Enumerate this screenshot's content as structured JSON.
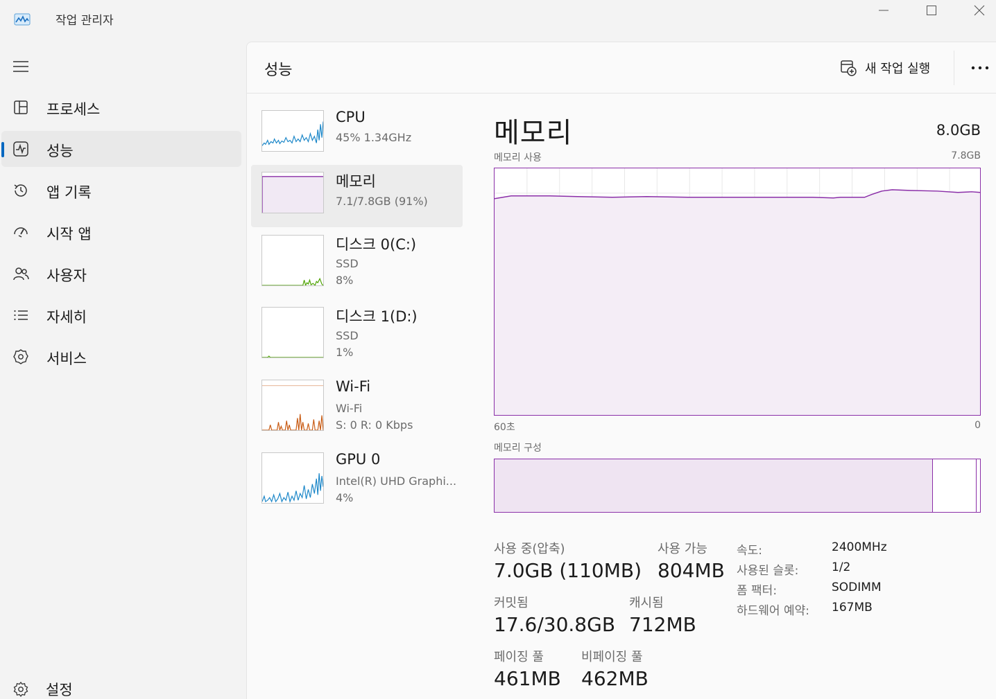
{
  "window": {
    "title": "작업 관리자",
    "icon": "task-manager-icon"
  },
  "sidebar": {
    "items": [
      {
        "label": "프로세스",
        "icon": "processes-icon"
      },
      {
        "label": "성능",
        "icon": "performance-icon",
        "active": true
      },
      {
        "label": "앱 기록",
        "icon": "history-icon"
      },
      {
        "label": "시작 앱",
        "icon": "startup-icon"
      },
      {
        "label": "사용자",
        "icon": "users-icon"
      },
      {
        "label": "자세히",
        "icon": "details-icon"
      },
      {
        "label": "서비스",
        "icon": "services-icon"
      }
    ],
    "settings_label": "설정"
  },
  "header": {
    "title": "성능",
    "run_task_label": "새 작업 실행"
  },
  "devices": [
    {
      "name": "CPU",
      "sub1": "45% 1.34GHz",
      "sub2": "",
      "color": "#1a86c8"
    },
    {
      "name": "메모리",
      "sub1": "7.1/7.8GB (91%)",
      "sub2": "",
      "color": "#8a2ea8",
      "selected": true
    },
    {
      "name": "디스크 0(C:)",
      "sub1": "SSD",
      "sub2": "8%",
      "color": "#4da200"
    },
    {
      "name": "디스크 1(D:)",
      "sub1": "SSD",
      "sub2": "1%",
      "color": "#4da200"
    },
    {
      "name": "Wi-Fi",
      "sub1": "Wi-Fi",
      "sub2": "S: 0 R: 0 Kbps",
      "color": "#c85a12"
    },
    {
      "name": "GPU 0",
      "sub1": "Intel(R) UHD Graphi...",
      "sub2": "4%",
      "color": "#1a86c8"
    }
  ],
  "memory": {
    "title": "메모리",
    "total": "8.0GB",
    "usage_label": "메모리 사용",
    "usage_max": "7.8GB",
    "axis_left": "60초",
    "axis_right": "0",
    "composition_label": "메모리 구성",
    "usage_fraction": 0.9,
    "composition": {
      "in_use_fraction": 0.9,
      "standby_fraction": 0.095
    },
    "stats": {
      "in_use_label": "사용 중(압축)",
      "in_use_value": "7.0GB (110MB)",
      "available_label": "사용 가능",
      "available_value": "804MB",
      "committed_label": "커밋됨",
      "committed_value": "17.6/30.8GB",
      "cached_label": "캐시됨",
      "cached_value": "712MB",
      "paged_label": "페이징 풀",
      "paged_value": "461MB",
      "nonpaged_label": "비페이징 풀",
      "nonpaged_value": "462MB"
    },
    "props": [
      {
        "key": "속도:",
        "value": "2400MHz"
      },
      {
        "key": "사용된 슬롯:",
        "value": "1/2"
      },
      {
        "key": "폼 팩터:",
        "value": "SODIMM"
      },
      {
        "key": "하드웨어 예약:",
        "value": "167MB"
      }
    ],
    "accent": "#8a2ea8",
    "fill": "#f1e9f4"
  }
}
